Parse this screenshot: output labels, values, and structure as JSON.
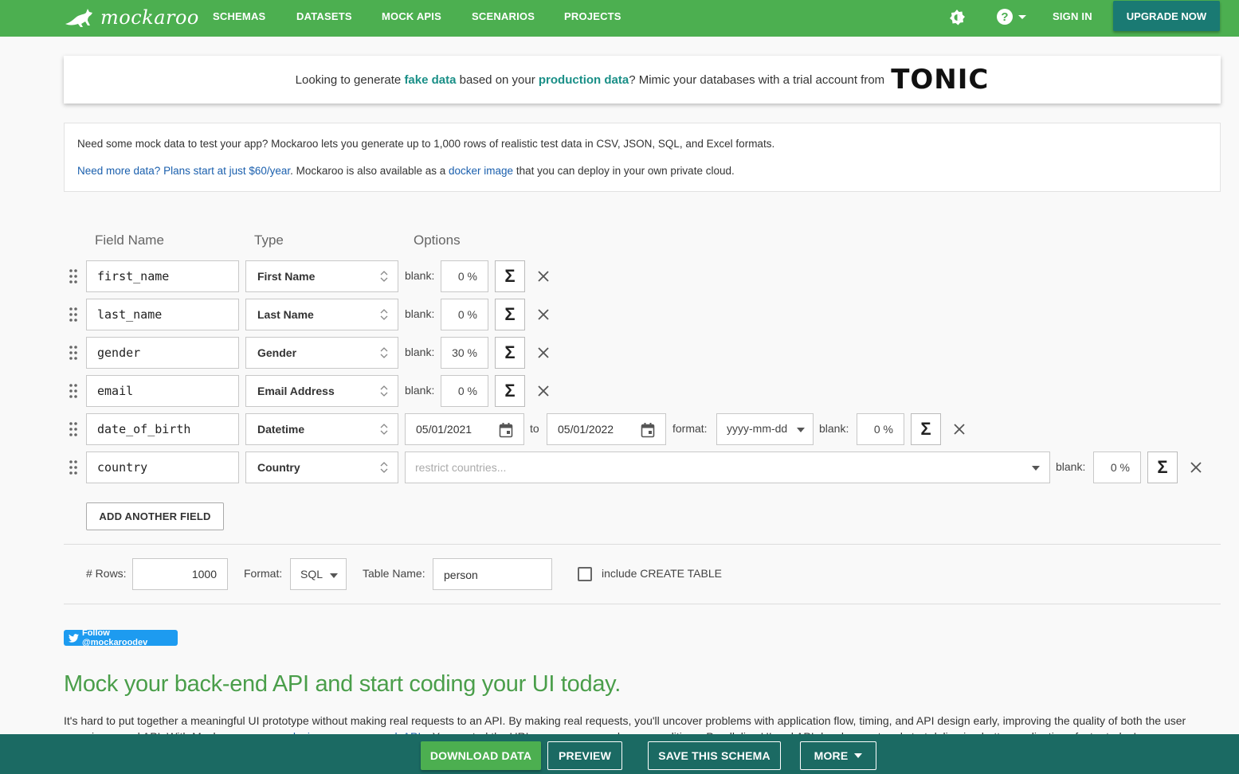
{
  "nav": {
    "logo_text": "mockaroo",
    "items": [
      "SCHEMAS",
      "DATASETS",
      "MOCK APIS",
      "SCENARIOS",
      "PROJECTS"
    ],
    "sign_in": "SIGN IN",
    "upgrade": "UPGRADE NOW"
  },
  "banner": {
    "prefix": "Looking to generate ",
    "fake_data": "fake data",
    "middle": " based on your ",
    "production_data": "production data",
    "suffix": "? Mimic your databases with a trial account from",
    "brand": "TONIC"
  },
  "info": {
    "line1": "Need some mock data to test your app? Mockaroo lets you generate up to 1,000 rows of realistic test data in CSV, JSON, SQL, and Excel formats.",
    "plans_link": "Need more data? Plans start at just $60/year",
    "line2_mid": ". Mockaroo is also available as a ",
    "docker_link": "docker image",
    "line2_end": " that you can deploy in your own private cloud."
  },
  "schema": {
    "headers": {
      "field_name": "Field Name",
      "type": "Type",
      "options": "Options"
    },
    "blank_label": "blank:",
    "fields": [
      {
        "name": "first_name",
        "type": "First Name",
        "blank": "0 %"
      },
      {
        "name": "last_name",
        "type": "Last Name",
        "blank": "0 %"
      },
      {
        "name": "gender",
        "type": "Gender",
        "blank": "30 %"
      },
      {
        "name": "email",
        "type": "Email Address",
        "blank": "0 %"
      },
      {
        "name": "date_of_birth",
        "type": "Datetime",
        "blank": "0 %",
        "from": "05/01/2021",
        "to_label": "to",
        "to": "05/01/2022",
        "format_label": "format:",
        "format": "yyyy-mm-dd"
      },
      {
        "name": "country",
        "type": "Country",
        "blank": "0 %",
        "placeholder": "restrict countries..."
      }
    ],
    "add_field": "ADD ANOTHER FIELD"
  },
  "options": {
    "rows_label": "# Rows:",
    "rows": "1000",
    "format_label": "Format:",
    "format": "SQL",
    "table_label": "Table Name:",
    "table": "person",
    "create_table_label": "include CREATE TABLE"
  },
  "twitter": "Follow @mockaroodev",
  "heading": "Mock your back-end API and start coding your UI today.",
  "paragraph": {
    "text1": "It's hard to put together a meaningful UI prototype without making real requests to an API. By making real requests, you'll uncover problems with application flow, timing, and API design early, improving the quality of both the user experience and API. With Mockaroo, you can ",
    "link": "design your own mock APIs",
    "text2": ". You control the URLs, responses, and error conditions. Parallelize UI and API development and start delivering better applications faster today!"
  },
  "bottom": {
    "download": "DOWNLOAD DATA",
    "preview": "PREVIEW",
    "save": "SAVE THIS SCHEMA",
    "more": "MORE"
  },
  "colors": {
    "nav_green": "#4caf50",
    "teal": "#1a7a73",
    "bottom_bar": "#1b6a63",
    "heading_green": "#4a9e4a"
  }
}
